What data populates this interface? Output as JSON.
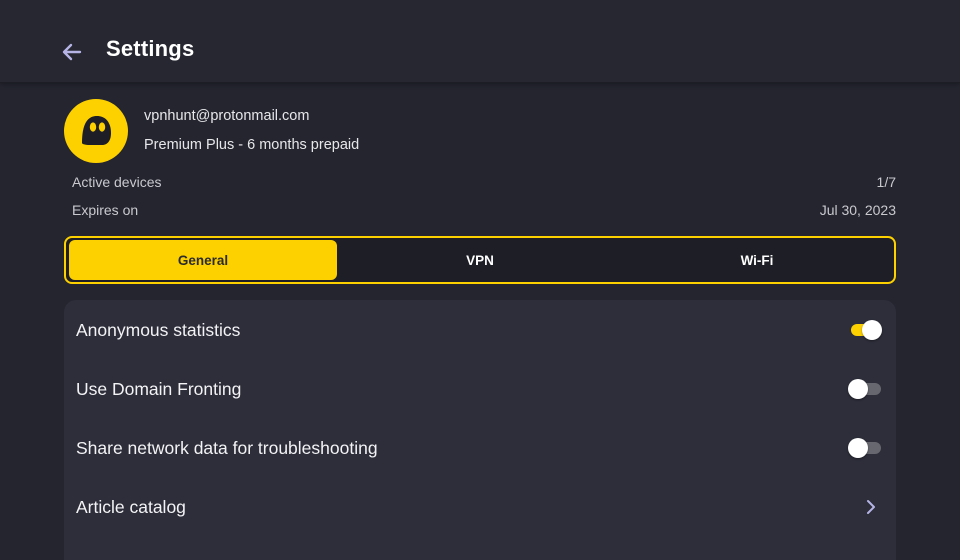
{
  "header": {
    "title": "Settings",
    "back_icon": "arrow-left-icon"
  },
  "account": {
    "email": "vpnhunt@protonmail.com",
    "plan": "Premium Plus - 6 months prepaid",
    "active_devices_label": "Active devices",
    "active_devices_value": "1/7",
    "expires_label": "Expires on",
    "expires_value": "Jul 30, 2023",
    "logo_icon": "cyberghost-logo-icon"
  },
  "tabs": [
    {
      "label": "General",
      "active": true
    },
    {
      "label": "VPN",
      "active": false
    },
    {
      "label": "Wi-Fi",
      "active": false
    }
  ],
  "settings": [
    {
      "label": "Anonymous statistics",
      "type": "toggle",
      "enabled": true
    },
    {
      "label": "Use Domain Fronting",
      "type": "toggle",
      "enabled": false
    },
    {
      "label": "Share network data for troubleshooting",
      "type": "toggle",
      "enabled": false
    },
    {
      "label": "Article catalog",
      "type": "link",
      "icon": "chevron-right-icon"
    }
  ],
  "colors": {
    "accent": "#fdd000",
    "background": "#24252f",
    "panel": "#2d2e3a"
  }
}
